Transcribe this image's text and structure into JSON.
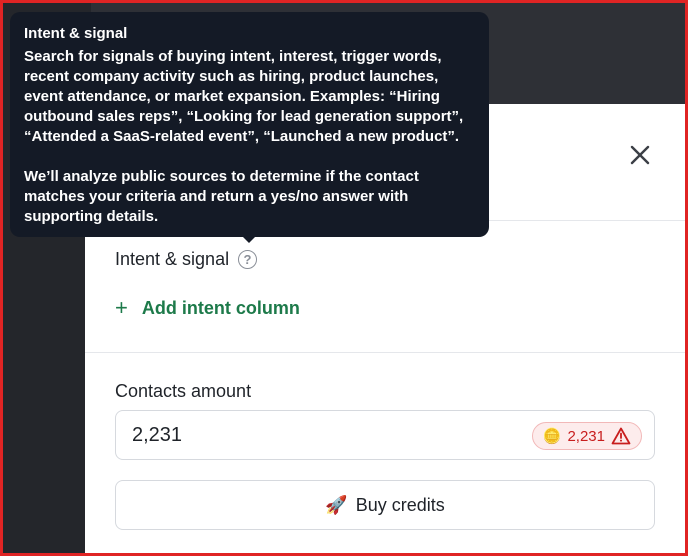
{
  "tooltip": {
    "title": "Intent & signal",
    "body": "Search for signals of buying intent, interest, trigger words, recent company activity such as hiring, product launches, event attendance, or market expansion. Examples: “Hiring outbound sales reps”, “Looking for lead generation support”, “Attended a SaaS-related event”, “Launched a new product”.",
    "body2": "We’ll analyze public sources to determine if the contact matches your criteria and return a yes/no answer with supporting details."
  },
  "modal": {
    "close_icon": "close-icon",
    "intent_section": {
      "label": "Intent & signal",
      "help_icon": "question-circle-icon",
      "help_glyph": "?",
      "add_button": {
        "icon": "plus-icon",
        "icon_glyph": "+",
        "label": "Add intent column"
      }
    },
    "contacts": {
      "label": "Contacts amount",
      "value": "2,231",
      "badge": {
        "icon": "coins-icon",
        "count": "2,231",
        "warning_icon": "warning-icon",
        "color": "#c81e1e"
      }
    },
    "buy_button": {
      "icon": "rocket-icon",
      "label": "Buy credits"
    }
  },
  "colors": {
    "accent_green": "#1d7a4a",
    "tooltip_bg": "#141a26",
    "backdrop": "#2e3036",
    "frame_border": "#e02424"
  }
}
